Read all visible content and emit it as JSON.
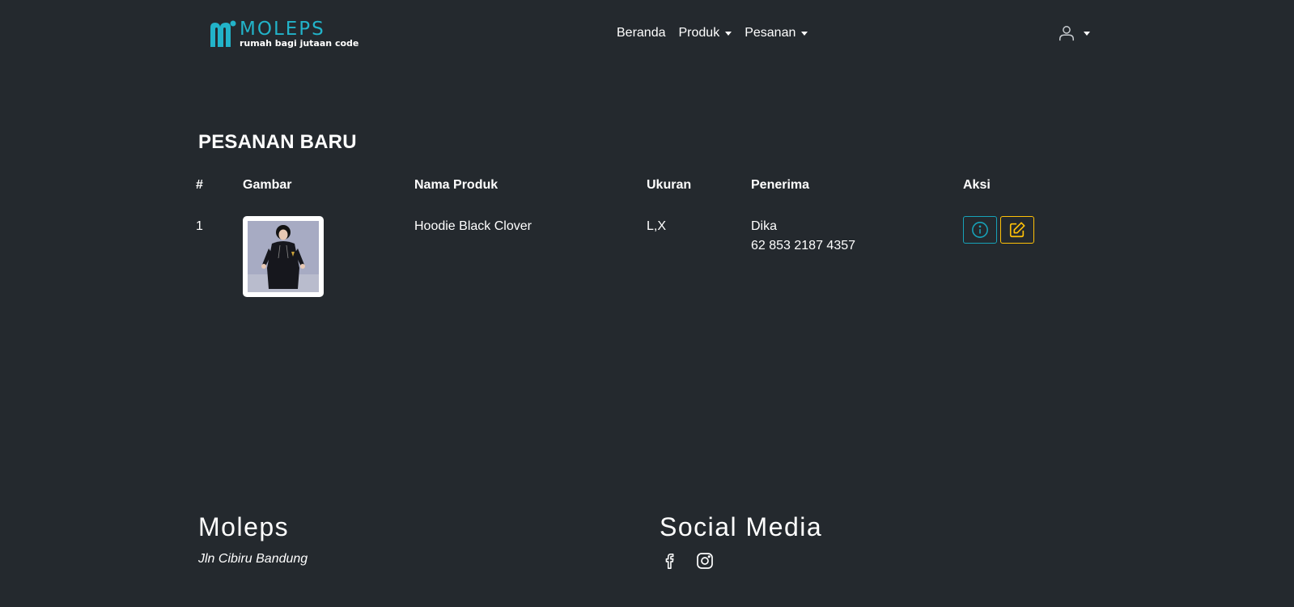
{
  "brand": {
    "name": "MOLEPS",
    "tagline": "rumah bagi jutaan code",
    "color": "#22b3c9"
  },
  "nav": {
    "items": [
      {
        "label": "Beranda",
        "dropdown": false
      },
      {
        "label": "Produk",
        "dropdown": true
      },
      {
        "label": "Pesanan",
        "dropdown": true
      }
    ],
    "user_icon": "user-icon"
  },
  "main": {
    "title": "PESANAN BARU",
    "columns": [
      "#",
      "Gambar",
      "Nama Produk",
      "Ukuran",
      "Penerima",
      "Aksi"
    ],
    "rows": [
      {
        "no": "1",
        "image_icon": "product-photo",
        "product_name": "Hoodie Black Clover",
        "size": "L,X",
        "recipient_name": "Dika",
        "recipient_phone": "62 853 2187 4357",
        "actions": [
          "info-icon",
          "edit-icon"
        ]
      }
    ]
  },
  "footer": {
    "company": "Moleps",
    "address": "Jln Cibiru Bandung",
    "social_title": "Social Media",
    "social_icons": [
      "facebook-icon",
      "instagram-icon"
    ]
  },
  "colors": {
    "background": "#24292e",
    "info": "#17a2b8",
    "warning": "#ffc107"
  }
}
